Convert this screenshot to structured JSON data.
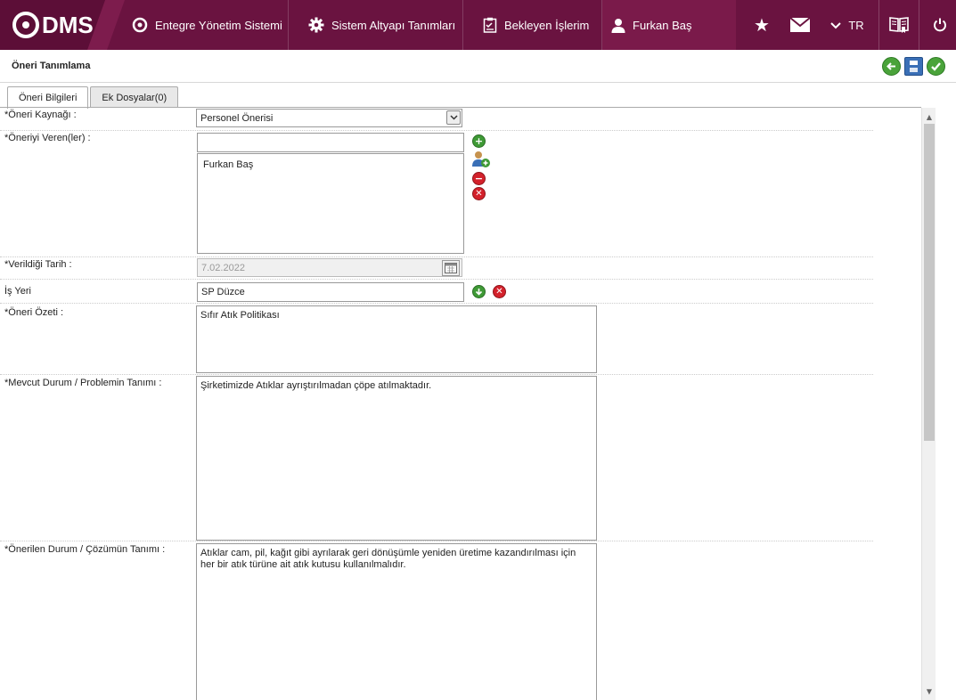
{
  "header": {
    "logo_text": "DMS",
    "nav": [
      {
        "label": "Entegre Yönetim Sistemi",
        "icon": "qdms-circle-icon"
      },
      {
        "label": "Sistem Altyapı Tanımları",
        "icon": "gear-icon"
      },
      {
        "label": "Bekleyen İşlerim",
        "icon": "clipboard-icon"
      },
      {
        "label": "Furkan Baş",
        "icon": "user-icon"
      }
    ],
    "lang": "TR",
    "accent": "#6a1340"
  },
  "page": {
    "title": "Öneri Tanımlama"
  },
  "tabs": [
    {
      "label": "Öneri Bilgileri",
      "active": true
    },
    {
      "label": "Ek Dosyalar(0)",
      "active": false
    }
  ],
  "form": {
    "source": {
      "label": "*Öneri Kaynağı :",
      "value": "Personel Önerisi"
    },
    "givers": {
      "label": "*Öneriyi Veren(ler) :",
      "input": "",
      "list": [
        "Furkan Baş"
      ]
    },
    "date": {
      "label": "*Verildiği Tarih :",
      "value": "7.02.2022"
    },
    "workplace": {
      "label": "İş Yeri",
      "value": "SP Düzce"
    },
    "summary": {
      "label": "*Öneri Özeti :",
      "value": "Sıfır Atık Politikası"
    },
    "current": {
      "label": "*Mevcut Durum / Problemin Tanımı :",
      "value": "Şirketimizde Atıklar ayrıştırılmadan çöpe atılmaktadır."
    },
    "proposed": {
      "label": "*Önerilen Durum / Çözümün Tanımı :",
      "value": "Atıklar cam, pil, kağıt gibi ayrılarak geri dönüşümle yeniden üretime kazandırılması için her bir atık türüne ait atık kutusu kullanılmalıdır."
    }
  }
}
